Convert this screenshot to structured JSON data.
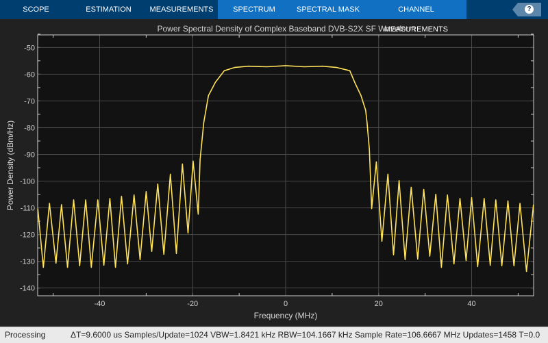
{
  "tabs": [
    {
      "label": "SCOPE",
      "group": false
    },
    {
      "label": "ESTIMATION",
      "group": false
    },
    {
      "label": "MEASUREMENTS",
      "group": false
    },
    {
      "label": "SPECTRUM",
      "group": true
    },
    {
      "label": "SPECTRAL MASK",
      "group": true
    },
    {
      "label": "CHANNEL MEASUREMENTS",
      "group": true
    }
  ],
  "help_label": "?",
  "status": {
    "state": "Processing",
    "info": "ΔT=9.6000 us  Samples/Update=1024  VBW=1.8421 kHz  RBW=104.1667 kHz  Sample Rate=106.6667 MHz  Updates=1458  T=0.0"
  },
  "colors": {
    "trace": "#ffe25a",
    "tabbar": "#003e70",
    "active_group": "#1170c1",
    "plot_bg": "#121212",
    "grid": "#4a4a4a"
  },
  "chart_data": {
    "type": "line",
    "title": "Power Spectral Density of Complex Baseband DVB-S2X SF Waveform",
    "xlabel": "Frequency (MHz)",
    "ylabel": "Power Density (dBm/Hz)",
    "xlim": [
      -53.33,
      53.33
    ],
    "ylim": [
      -142.9,
      -45.3
    ],
    "xticks": [
      -40,
      -20,
      0,
      20,
      40
    ],
    "yticks": [
      -50,
      -60,
      -70,
      -80,
      -90,
      -100,
      -110,
      -120,
      -130,
      -140
    ],
    "grid": true,
    "series": [
      {
        "points": [
          [
            -53.3,
            -110.3
          ],
          [
            -52.1,
            -132.3
          ],
          [
            -50.8,
            -108.3
          ],
          [
            -49.4,
            -130.7
          ],
          [
            -48.2,
            -108.8
          ],
          [
            -46.9,
            -132.3
          ],
          [
            -45.6,
            -107
          ],
          [
            -44.3,
            -131.7
          ],
          [
            -43.0,
            -107
          ],
          [
            -41.8,
            -132.3
          ],
          [
            -40.4,
            -107
          ],
          [
            -39.1,
            -131.5
          ],
          [
            -37.8,
            -106.5
          ],
          [
            -36.6,
            -132.3
          ],
          [
            -35.3,
            -105.7
          ],
          [
            -34.0,
            -131
          ],
          [
            -32.6,
            -105.2
          ],
          [
            -31.3,
            -129.4
          ],
          [
            -30.0,
            -103.9
          ],
          [
            -28.8,
            -126.3
          ],
          [
            -27.5,
            -101.1
          ],
          [
            -26.2,
            -127.4
          ],
          [
            -24.8,
            -97.4
          ],
          [
            -23.5,
            -127.1
          ],
          [
            -22.2,
            -93.6
          ],
          [
            -21.0,
            -119.4
          ],
          [
            -19.9,
            -92.5
          ],
          [
            -18.8,
            -112.4
          ],
          [
            -18.4,
            -92
          ],
          [
            -18.0,
            -85
          ],
          [
            -17.6,
            -78
          ],
          [
            -16.6,
            -68
          ],
          [
            -15.1,
            -63
          ],
          [
            -13.2,
            -58.7
          ],
          [
            -11,
            -57.5
          ],
          [
            -8,
            -57
          ],
          [
            -4,
            -57.2
          ],
          [
            0,
            -56.8
          ],
          [
            4,
            -57.2
          ],
          [
            8,
            -57
          ],
          [
            11,
            -57.5
          ],
          [
            13.8,
            -58.7
          ],
          [
            15.0,
            -63.6
          ],
          [
            16.2,
            -68
          ],
          [
            17.2,
            -73.5
          ],
          [
            17.5,
            -78
          ],
          [
            18.0,
            -88
          ],
          [
            18.5,
            -110.3
          ],
          [
            19.5,
            -92.8
          ],
          [
            20.7,
            -122.5
          ],
          [
            22.0,
            -97.4
          ],
          [
            23.2,
            -127.6
          ],
          [
            24.4,
            -99.8
          ],
          [
            25.7,
            -129.4
          ],
          [
            27.0,
            -102.3
          ],
          [
            28.4,
            -129.2
          ],
          [
            29.7,
            -103.1
          ],
          [
            31.0,
            -128.1
          ],
          [
            32.3,
            -104.9
          ],
          [
            33.5,
            -132.3
          ],
          [
            34.8,
            -105.2
          ],
          [
            36.2,
            -131
          ],
          [
            37.5,
            -106.5
          ],
          [
            38.8,
            -129.7
          ],
          [
            40.0,
            -106.2
          ],
          [
            41.3,
            -132
          ],
          [
            42.7,
            -106.5
          ],
          [
            44.0,
            -131.5
          ],
          [
            45.2,
            -107
          ],
          [
            46.5,
            -131.7
          ],
          [
            47.8,
            -107.4
          ],
          [
            49.1,
            -131.7
          ],
          [
            50.4,
            -108.3
          ],
          [
            51.8,
            -133.8
          ],
          [
            53.3,
            -108.8
          ]
        ]
      }
    ]
  }
}
